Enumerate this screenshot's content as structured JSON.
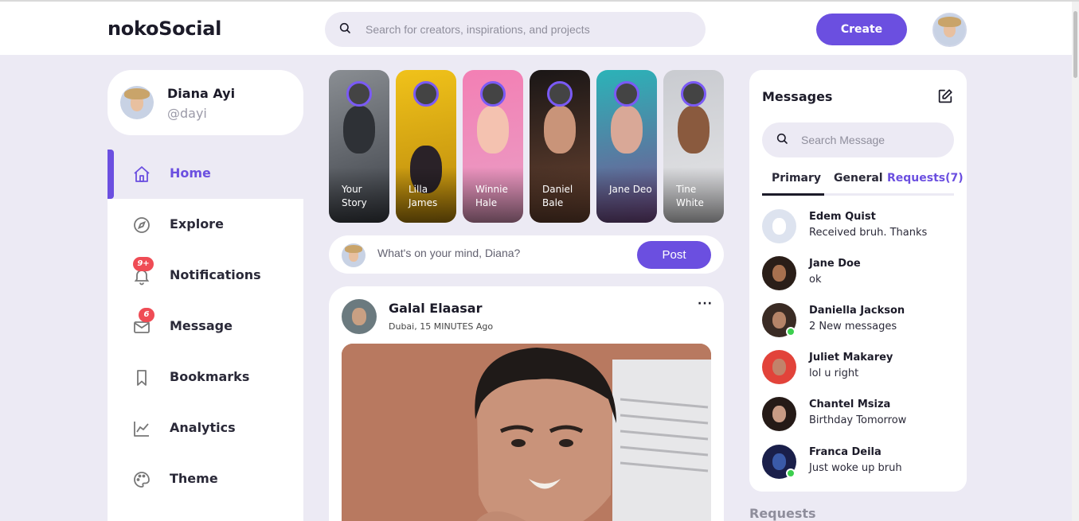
{
  "navbar": {
    "logo": "nokoSocial",
    "search_placeholder": "Search for creators, inspirations, and projects",
    "create_label": "Create"
  },
  "profile": {
    "name": "Diana Ayi",
    "handle": "@dayi"
  },
  "menu": {
    "items": [
      {
        "label": "Home",
        "icon": "home-icon",
        "active": true
      },
      {
        "label": "Explore",
        "icon": "compass-icon"
      },
      {
        "label": "Notifications",
        "icon": "bell-icon",
        "badge": "9+"
      },
      {
        "label": "Message",
        "icon": "mail-icon",
        "badge": "6"
      },
      {
        "label": "Bookmarks",
        "icon": "bookmark-icon"
      },
      {
        "label": "Analytics",
        "icon": "analytics-icon"
      },
      {
        "label": "Theme",
        "icon": "palette-icon"
      }
    ]
  },
  "stories": [
    {
      "name": "Your Story"
    },
    {
      "name": "Lilla James"
    },
    {
      "name": "Winnie Hale"
    },
    {
      "name": "Daniel Bale"
    },
    {
      "name": "Jane Deo"
    },
    {
      "name": "Tine White"
    }
  ],
  "post_box": {
    "placeholder": "What's on your mind, Diana?",
    "post_label": "Post"
  },
  "feed": [
    {
      "author": "Galal Elaasar",
      "meta": "Dubai, 15 MINUTES Ago",
      "more": "···"
    }
  ],
  "messages": {
    "title": "Messages",
    "search_placeholder": "Search Message",
    "tabs": [
      "Primary",
      "General",
      "Requests(7)"
    ],
    "conversations": [
      {
        "name": "Edem Quist",
        "text": "Received bruh. Thanks",
        "online": false
      },
      {
        "name": "Jane Doe",
        "text": "ok",
        "online": false
      },
      {
        "name": "Daniella Jackson",
        "text": "2 New messages",
        "online": true
      },
      {
        "name": "Juliet Makarey",
        "text": "lol u right",
        "online": false
      },
      {
        "name": "Chantel Msiza",
        "text": "Birthday Tomorrow",
        "online": false
      },
      {
        "name": "Franca Deila",
        "text": "Just woke up bruh",
        "online": true
      }
    ]
  },
  "requests_heading": "Requests",
  "colors": {
    "accent": "#6b4fe0",
    "background": "#eceaf4",
    "badge": "#ef4c55",
    "online": "#3ccf4e"
  }
}
